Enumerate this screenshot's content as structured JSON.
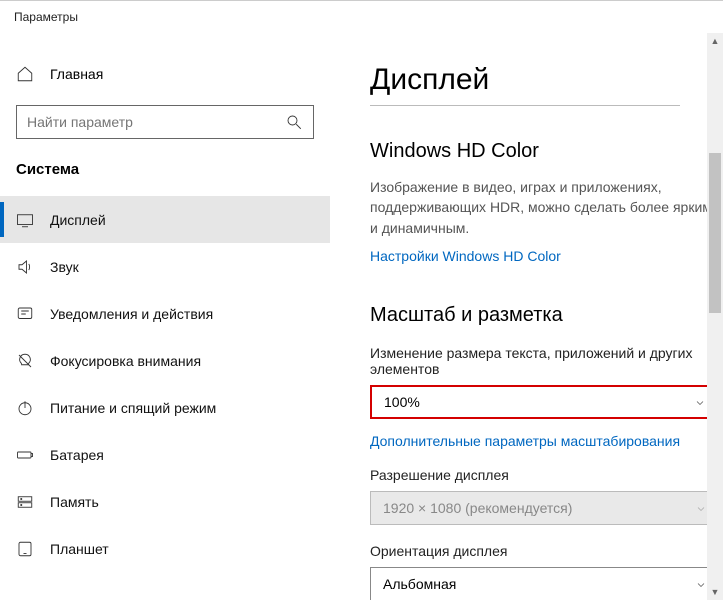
{
  "window": {
    "title": "Параметры"
  },
  "sidebar": {
    "home": "Главная",
    "search_placeholder": "Найти параметр",
    "section": "Система",
    "items": [
      {
        "label": "Дисплей"
      },
      {
        "label": "Звук"
      },
      {
        "label": "Уведомления и действия"
      },
      {
        "label": "Фокусировка внимания"
      },
      {
        "label": "Питание и спящий режим"
      },
      {
        "label": "Батарея"
      },
      {
        "label": "Память"
      },
      {
        "label": "Планшет"
      }
    ]
  },
  "main": {
    "title": "Дисплей",
    "hd": {
      "heading": "Windows HD Color",
      "desc": "Изображение в видео, играх и приложениях, поддерживающих HDR, можно сделать более ярким и динамичным.",
      "link": "Настройки Windows HD Color"
    },
    "scale": {
      "heading": "Масштаб и разметка",
      "text_size_label": "Изменение размера текста, приложений и других элементов",
      "text_size_value": "100%",
      "advanced_link": "Дополнительные параметры масштабирования",
      "resolution_label": "Разрешение дисплея",
      "resolution_value": "1920 × 1080 (рекомендуется)",
      "orientation_label": "Ориентация дисплея",
      "orientation_value": "Альбомная"
    }
  }
}
